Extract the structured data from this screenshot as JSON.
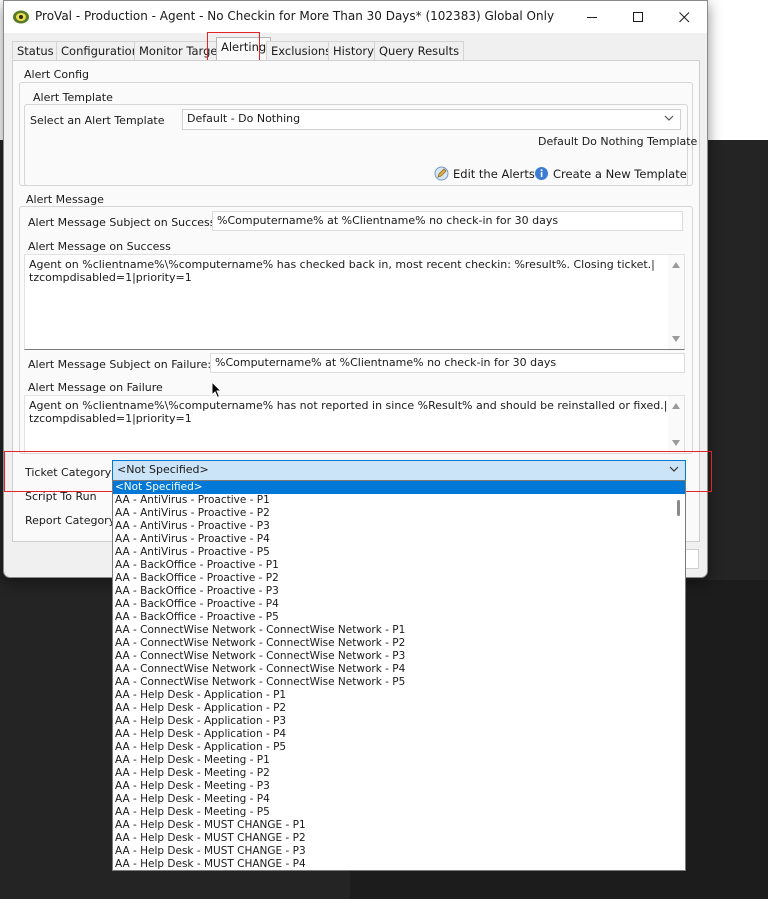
{
  "window": {
    "title": "ProVal - Production - Agent - No Checkin for More Than 30 Days* (102383) Global Only",
    "minimize_icon": "minimize-icon",
    "maximize_icon": "maximize-icon",
    "close_icon": "close-icon"
  },
  "tabs": [
    {
      "label": "Status"
    },
    {
      "label": "Configuration"
    },
    {
      "label": "Monitor Target"
    },
    {
      "label": "Alerting",
      "active": true
    },
    {
      "label": "Exclusions"
    },
    {
      "label": "History"
    },
    {
      "label": "Query Results"
    }
  ],
  "alert_config": {
    "group_label": "Alert Config",
    "template_group_label": "Alert Template",
    "select_template_label": "Select an Alert Template",
    "template_value": "Default - Do Nothing",
    "template_description": "Default Do Nothing Template",
    "edit_alerts_label": "Edit the Alerts",
    "new_template_label": "Create a New Template"
  },
  "alert_message": {
    "section_label": "Alert Message",
    "subject_success_label": "Alert Message Subject on Success:",
    "subject_success_value": "%Computername% at %Clientname% no check-in for 30 days",
    "message_success_label": "Alert Message on Success",
    "message_success_line1": "Agent on %clientname%\\%computername% has checked back in, most recent checkin: %result%. Closing ticket.|",
    "message_success_line2": "tzcompdisabled=1|priority=1",
    "subject_failure_label": "Alert Message Subject on Failure:",
    "subject_failure_value": "%Computername% at %Clientname% no check-in for 30 days",
    "message_failure_label": "Alert Message on Failure",
    "message_failure_line1": "Agent on %clientname%\\%computername% has not reported in since %Result% and should be reinstalled or fixed.|",
    "message_failure_line2": "tzcompdisabled=1|priority=1"
  },
  "ticket": {
    "category_label": "Ticket Category",
    "category_value": "<Not Specified>",
    "script_label": "Script To Run",
    "report_label": "Report Category"
  },
  "dropdown_options": [
    "<Not Specified>",
    "AA - AntiVirus - Proactive - P1",
    "AA - AntiVirus - Proactive - P2",
    "AA - AntiVirus - Proactive - P3",
    "AA - AntiVirus - Proactive - P4",
    "AA - AntiVirus - Proactive - P5",
    "AA - BackOffice - Proactive - P1",
    "AA - BackOffice - Proactive - P2",
    "AA - BackOffice - Proactive - P3",
    "AA - BackOffice - Proactive - P4",
    "AA - BackOffice - Proactive - P5",
    "AA - ConnectWise Network - ConnectWise Network - P1",
    "AA - ConnectWise Network - ConnectWise Network - P2",
    "AA - ConnectWise Network - ConnectWise Network - P3",
    "AA - ConnectWise Network - ConnectWise Network - P4",
    "AA - ConnectWise Network - ConnectWise Network - P5",
    "AA - Help Desk - Application - P1",
    "AA - Help Desk - Application - P2",
    "AA - Help Desk - Application - P3",
    "AA - Help Desk - Application - P4",
    "AA - Help Desk - Application - P5",
    "AA - Help Desk - Meeting - P1",
    "AA - Help Desk - Meeting - P2",
    "AA - Help Desk - Meeting - P3",
    "AA - Help Desk - Meeting - P4",
    "AA - Help Desk - Meeting - P5",
    "AA - Help Desk - MUST CHANGE - P1",
    "AA - Help Desk - MUST CHANGE - P2",
    "AA - Help Desk - MUST CHANGE - P3",
    "AA - Help Desk - MUST CHANGE - P4"
  ],
  "colors": {
    "highlight_box": "#e02525",
    "selection": "#0078d7",
    "selected_combo_bg": "#cce4f7"
  }
}
